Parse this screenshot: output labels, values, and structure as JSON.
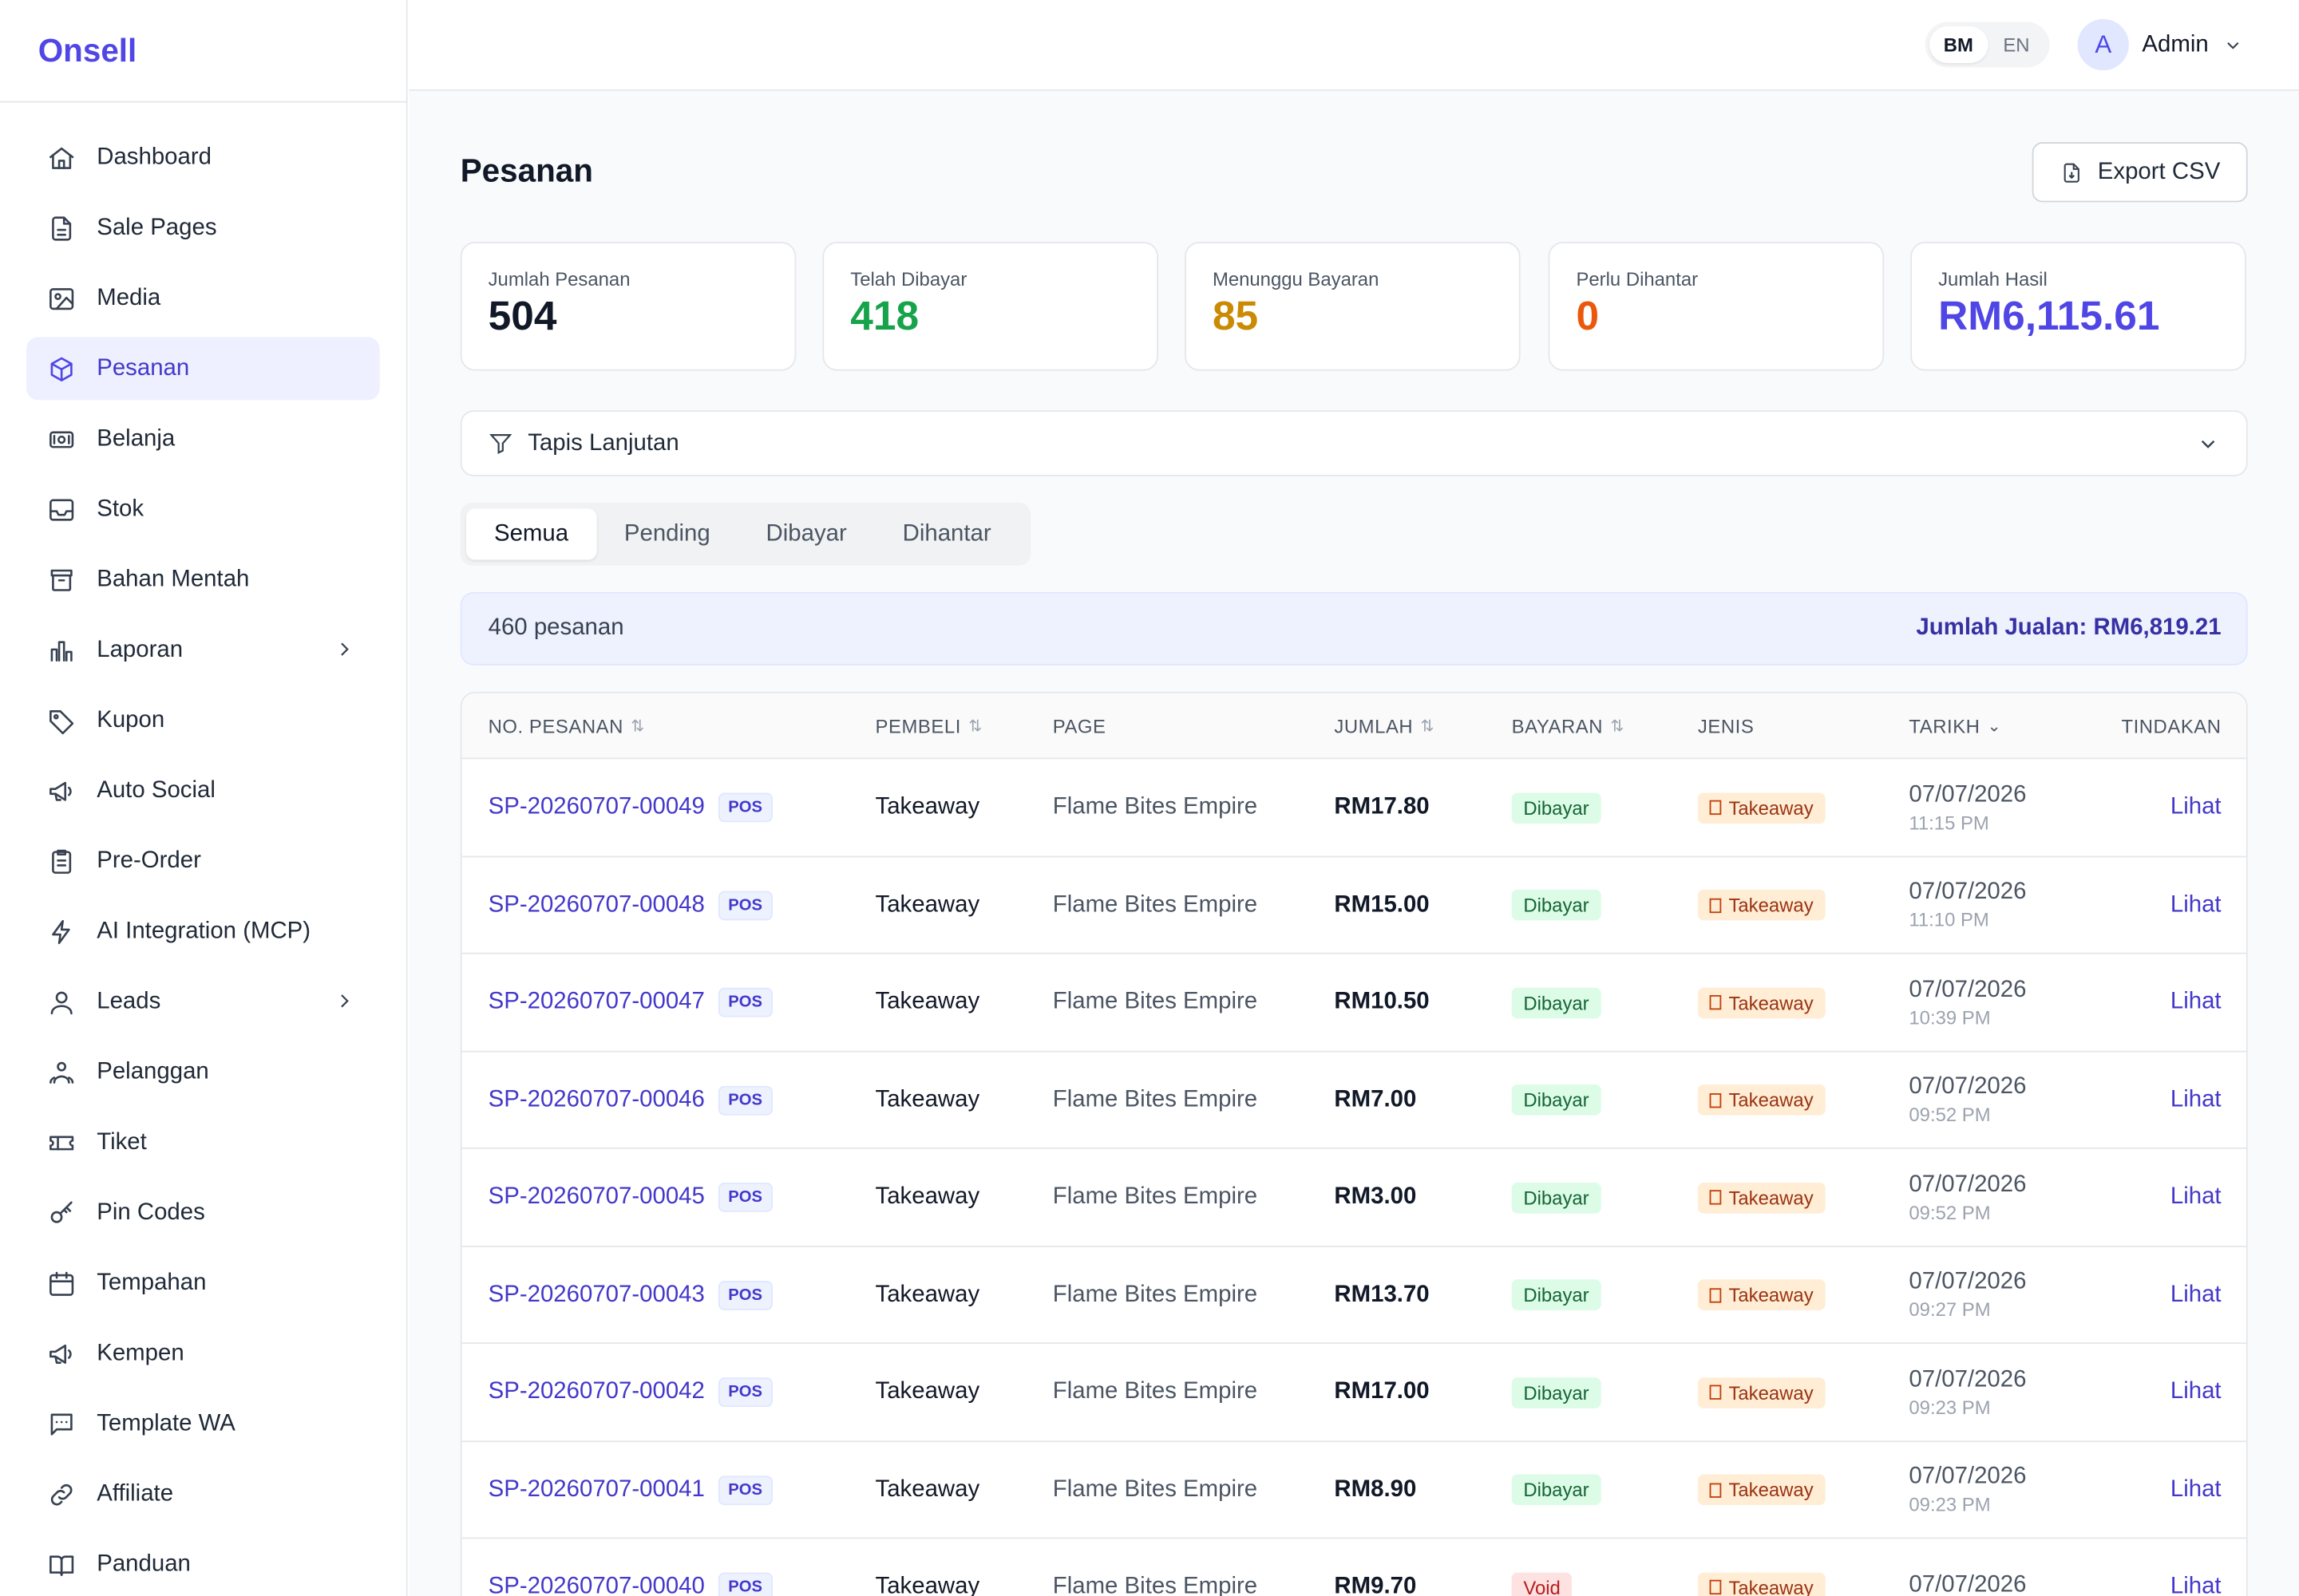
{
  "brand": "Onsell",
  "sidebar": {
    "items": [
      {
        "label": "Dashboard",
        "icon": "home-icon"
      },
      {
        "label": "Sale Pages",
        "icon": "document-icon"
      },
      {
        "label": "Media",
        "icon": "image-icon"
      },
      {
        "label": "Pesanan",
        "icon": "box-icon",
        "active": true
      },
      {
        "label": "Belanja",
        "icon": "cash-icon"
      },
      {
        "label": "Stok",
        "icon": "inbox-icon"
      },
      {
        "label": "Bahan Mentah",
        "icon": "archive-icon"
      },
      {
        "label": "Laporan",
        "icon": "bar-chart-icon",
        "expandable": true
      },
      {
        "label": "Kupon",
        "icon": "tag-icon"
      },
      {
        "label": "Auto Social",
        "icon": "megaphone-icon"
      },
      {
        "label": "Pre-Order",
        "icon": "clipboard-icon"
      },
      {
        "label": "AI Integration (MCP)",
        "icon": "bolt-icon"
      },
      {
        "label": "Leads",
        "icon": "user-icon",
        "expandable": true
      },
      {
        "label": "Pelanggan",
        "icon": "users-icon"
      },
      {
        "label": "Tiket",
        "icon": "ticket-icon"
      },
      {
        "label": "Pin Codes",
        "icon": "key-icon"
      },
      {
        "label": "Tempahan",
        "icon": "calendar-icon"
      },
      {
        "label": "Kempen",
        "icon": "megaphone-icon"
      },
      {
        "label": "Template WA",
        "icon": "chat-icon"
      },
      {
        "label": "Affiliate",
        "icon": "link-icon"
      },
      {
        "label": "Panduan",
        "icon": "book-icon"
      }
    ]
  },
  "header": {
    "lang": [
      "BM",
      "EN"
    ],
    "lang_active": "BM",
    "avatar_initial": "A",
    "user_name": "Admin"
  },
  "main": {
    "title": "Pesanan",
    "export_label": "Export CSV",
    "stats": [
      {
        "label": "Jumlah Pesanan",
        "value": "504",
        "color": "#111827"
      },
      {
        "label": "Telah Dibayar",
        "value": "418",
        "color": "#16a34a"
      },
      {
        "label": "Menunggu Bayaran",
        "value": "85",
        "color": "#ca8a04"
      },
      {
        "label": "Perlu Dihantar",
        "value": "0",
        "color": "#ea580c"
      },
      {
        "label": "Jumlah Hasil",
        "value": "RM6,115.61",
        "color": "#4f46e5"
      }
    ],
    "filter_label": "Tapis Lanjutan",
    "tabs": [
      "Semua",
      "Pending",
      "Dibayar",
      "Dihantar"
    ],
    "tab_active": "Semua",
    "summary": {
      "count": "460 pesanan",
      "total": "Jumlah Jualan: RM6,819.21"
    },
    "table": {
      "headers": {
        "no": "NO. PESANAN",
        "buyer": "PEMBELI",
        "page": "PAGE",
        "amount": "JUMLAH",
        "payment": "BAYARAN",
        "type": "JENIS",
        "date": "TARIKH",
        "action": "TINDAKAN"
      },
      "rows": [
        {
          "no": "SP-20260707-00049",
          "badge": "POS",
          "buyer": "Takeaway",
          "page": "Flame Bites Empire",
          "amount": "RM17.80",
          "payment": "Dibayar",
          "type": "Takeaway",
          "date": "07/07/2026",
          "time": "11:15 PM",
          "action": "Lihat"
        },
        {
          "no": "SP-20260707-00048",
          "badge": "POS",
          "buyer": "Takeaway",
          "page": "Flame Bites Empire",
          "amount": "RM15.00",
          "payment": "Dibayar",
          "type": "Takeaway",
          "date": "07/07/2026",
          "time": "11:10 PM",
          "action": "Lihat"
        },
        {
          "no": "SP-20260707-00047",
          "badge": "POS",
          "buyer": "Takeaway",
          "page": "Flame Bites Empire",
          "amount": "RM10.50",
          "payment": "Dibayar",
          "type": "Takeaway",
          "date": "07/07/2026",
          "time": "10:39 PM",
          "action": "Lihat"
        },
        {
          "no": "SP-20260707-00046",
          "badge": "POS",
          "buyer": "Takeaway",
          "page": "Flame Bites Empire",
          "amount": "RM7.00",
          "payment": "Dibayar",
          "type": "Takeaway",
          "date": "07/07/2026",
          "time": "09:52 PM",
          "action": "Lihat"
        },
        {
          "no": "SP-20260707-00045",
          "badge": "POS",
          "buyer": "Takeaway",
          "page": "Flame Bites Empire",
          "amount": "RM3.00",
          "payment": "Dibayar",
          "type": "Takeaway",
          "date": "07/07/2026",
          "time": "09:52 PM",
          "action": "Lihat"
        },
        {
          "no": "SP-20260707-00043",
          "badge": "POS",
          "buyer": "Takeaway",
          "page": "Flame Bites Empire",
          "amount": "RM13.70",
          "payment": "Dibayar",
          "type": "Takeaway",
          "date": "07/07/2026",
          "time": "09:27 PM",
          "action": "Lihat"
        },
        {
          "no": "SP-20260707-00042",
          "badge": "POS",
          "buyer": "Takeaway",
          "page": "Flame Bites Empire",
          "amount": "RM17.00",
          "payment": "Dibayar",
          "type": "Takeaway",
          "date": "07/07/2026",
          "time": "09:23 PM",
          "action": "Lihat"
        },
        {
          "no": "SP-20260707-00041",
          "badge": "POS",
          "buyer": "Takeaway",
          "page": "Flame Bites Empire",
          "amount": "RM8.90",
          "payment": "Dibayar",
          "type": "Takeaway",
          "date": "07/07/2026",
          "time": "09:23 PM",
          "action": "Lihat"
        },
        {
          "no": "SP-20260707-00040",
          "badge": "POS",
          "buyer": "Takeaway",
          "page": "Flame Bites Empire",
          "amount": "RM9.70",
          "payment": "Void",
          "type": "Takeaway",
          "date": "07/07/2026",
          "time": "",
          "action": "Lihat"
        }
      ]
    }
  }
}
